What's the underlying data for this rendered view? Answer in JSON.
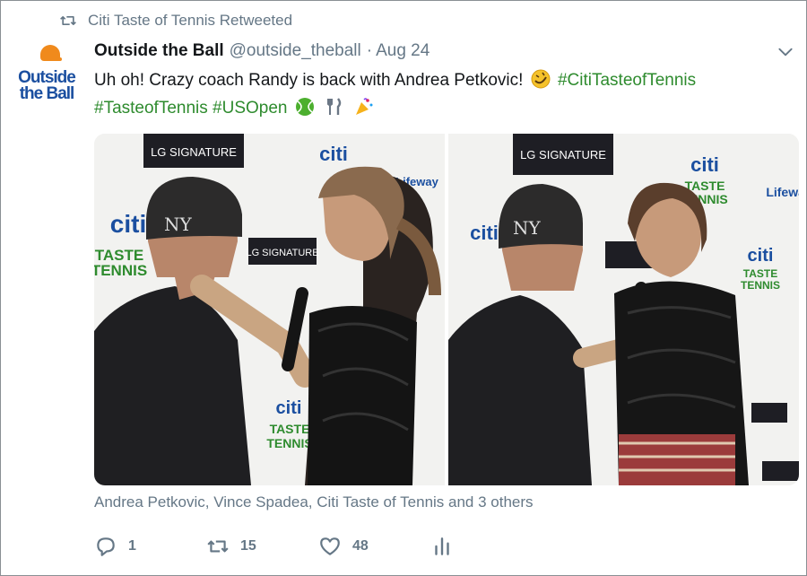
{
  "retweet": {
    "text": "Citi Taste of Tennis Retweeted"
  },
  "avatar": {
    "line1": "Outside",
    "line2": "the Ball"
  },
  "tweet": {
    "name": "Outside the Ball",
    "handle": "@outside_theball",
    "separator": "·",
    "date": "Aug 24",
    "text_part1": "Uh oh! Crazy coach Randy is back with Andrea Petkovic!",
    "hashtag1": "#CitiTasteofTennis",
    "hashtag2": "#TasteofTennis",
    "hashtag3": "#USOpen"
  },
  "photos": {
    "backdrop_lg": "LG SIGNATURE",
    "backdrop_lg_short": "LG SIGNATURE",
    "backdrop_citi": "citi",
    "backdrop_taste1": "TASTE",
    "backdrop_taste2": "TENNIS",
    "backdrop_lifeway": "Lifeway",
    "cap_logo": "NY"
  },
  "tagged": {
    "text": "Andrea Petkovic, Vince Spadea, Citi Taste of Tennis and 3 others"
  },
  "actions": {
    "replies": "1",
    "retweets": "15",
    "likes": "48"
  },
  "colors": {
    "hashtag": "#2e8b2e",
    "meta": "#657786",
    "brand_blue": "#1b4fa0",
    "citi_red": "#d7262c"
  }
}
